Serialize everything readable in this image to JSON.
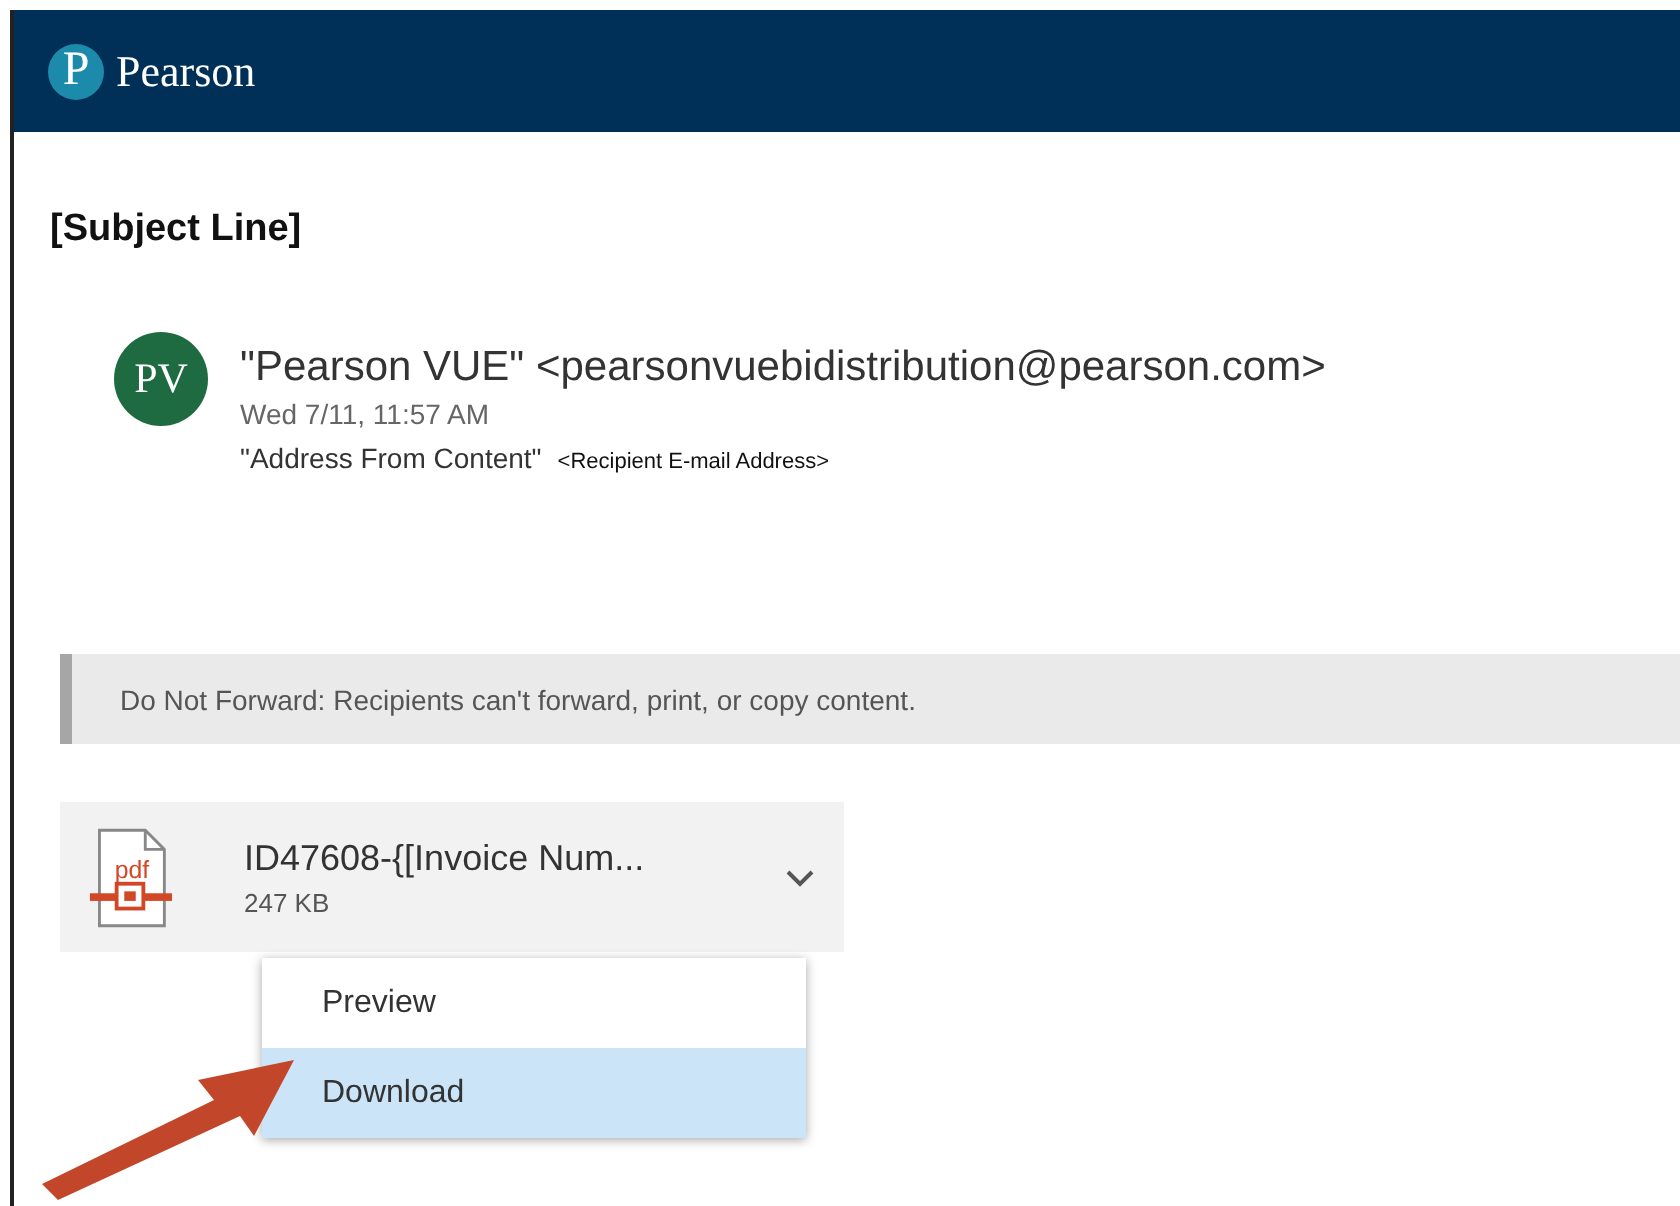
{
  "header": {
    "brand": "Pearson",
    "logo_letter": "P"
  },
  "subject": "[Subject Line]",
  "sender": {
    "initials": "PV",
    "from": "\"Pearson VUE\" <pearsonvuebidistribution@pearson.com>",
    "date": "Wed 7/11, 11:57 AM",
    "to_name": "\"Address From Content\"",
    "to_address": "<Recipient E-mail Address>"
  },
  "notice": "Do Not Forward: Recipients can't forward, print, or copy content.",
  "attachment": {
    "file_type": "pdf",
    "name": "ID47608-{[Invoice Num...",
    "size": "247 KB",
    "expanded": true
  },
  "menu": [
    {
      "label": "Preview",
      "selected": false
    },
    {
      "label": "Download",
      "selected": true
    }
  ]
}
